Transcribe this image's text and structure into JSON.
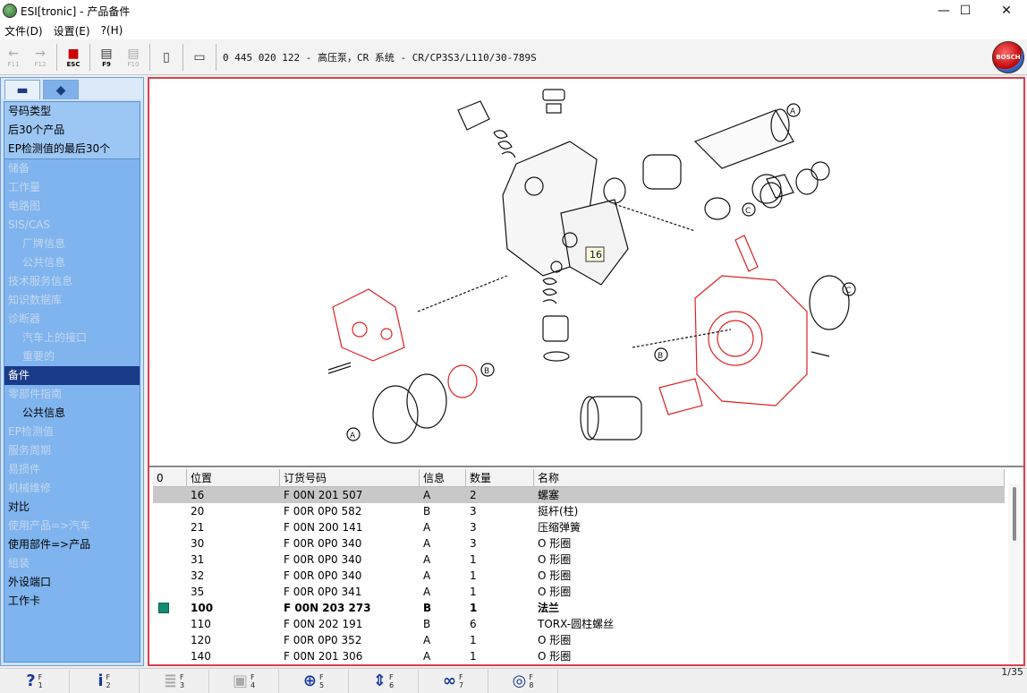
{
  "window": {
    "title": "ESI[tronic] - 产品备件",
    "minimize": "—",
    "maximize": "☐",
    "close": "✕"
  },
  "menu": [
    "文件(D)",
    "设置(E)",
    "?(H)"
  ],
  "toolbar": {
    "buttons": [
      {
        "icon": "arrow-left-icon",
        "glyph": "←",
        "key": "F11"
      },
      {
        "icon": "arrow-right-icon",
        "glyph": "→",
        "key": "F12"
      },
      {
        "icon": "esc-icon",
        "glyph": "■",
        "key": "ESC"
      },
      {
        "icon": "catalog-icon",
        "glyph": "▤",
        "key": "F9"
      },
      {
        "icon": "catalog-forward-icon",
        "glyph": "▤",
        "key": "F10"
      },
      {
        "icon": "document-icon",
        "glyph": "▯",
        "key": ""
      },
      {
        "icon": "print-icon",
        "glyph": "▭",
        "key": ""
      }
    ],
    "path": "0 445 020 122 - 高压泵，CR 系统 - CR/CP3S3/L110/30-789S",
    "logo_text": "BOSCH"
  },
  "sidebar": {
    "tabs": [
      {
        "icon": "car-icon",
        "glyph": "▬"
      },
      {
        "icon": "engine-icon",
        "glyph": "◆"
      }
    ],
    "top_items": [
      "号码类型",
      "后30个产品",
      "EP检测值的最后30个"
    ],
    "items": [
      {
        "label": "储备",
        "state": "grey",
        "indent": false
      },
      {
        "label": "工作量",
        "state": "grey",
        "indent": false
      },
      {
        "label": "电路图",
        "state": "grey",
        "indent": false
      },
      {
        "label": "SIS/CAS",
        "state": "grey",
        "indent": false
      },
      {
        "label": "厂牌信息",
        "state": "grey",
        "indent": true
      },
      {
        "label": "公共信息",
        "state": "grey",
        "indent": true
      },
      {
        "label": "技术服务信息",
        "state": "grey",
        "indent": false
      },
      {
        "label": "知识数据库",
        "state": "grey",
        "indent": false
      },
      {
        "label": "诊断器",
        "state": "grey",
        "indent": false
      },
      {
        "label": "汽车上的接口",
        "state": "grey",
        "indent": true
      },
      {
        "label": "重要的",
        "state": "grey",
        "indent": true
      },
      {
        "label": "备件",
        "state": "selected",
        "indent": false
      },
      {
        "label": "零部件指南",
        "state": "grey",
        "indent": false
      },
      {
        "label": "公共信息",
        "state": "normal",
        "indent": true
      },
      {
        "label": "EP检测值",
        "state": "grey",
        "indent": false
      },
      {
        "label": "服务周期",
        "state": "grey",
        "indent": false
      },
      {
        "label": "易损件",
        "state": "grey",
        "indent": false
      },
      {
        "label": "机械维修",
        "state": "grey",
        "indent": false
      },
      {
        "label": "对比",
        "state": "normal",
        "indent": false
      },
      {
        "label": "使用产品=>汽车",
        "state": "grey",
        "indent": false
      },
      {
        "label": "使用部件=>产品",
        "state": "normal",
        "indent": false
      },
      {
        "label": "组装",
        "state": "grey",
        "indent": false
      },
      {
        "label": "外设端口",
        "state": "normal",
        "indent": false
      },
      {
        "label": "工作卡",
        "state": "normal",
        "indent": false
      }
    ]
  },
  "diagram": {
    "callout": "16",
    "markers": [
      "A",
      "B",
      "C"
    ]
  },
  "table": {
    "columns": [
      "0",
      "位置",
      "订货号码",
      "信息",
      "数量",
      "名称"
    ],
    "rows": [
      {
        "pos": "16",
        "order": "F 00N 201 507",
        "info": "A",
        "qty": "2",
        "name": "螺塞",
        "state": "selected",
        "mark": false
      },
      {
        "pos": "20",
        "order": "F 00R 0P0 582",
        "info": "B",
        "qty": "3",
        "name": "挺杆(柱)",
        "state": "normal",
        "mark": false
      },
      {
        "pos": "21",
        "order": "F 00N 200 141",
        "info": "A",
        "qty": "3",
        "name": "压缩弹簧",
        "state": "normal",
        "mark": false
      },
      {
        "pos": "30",
        "order": "F 00R 0P0 340",
        "info": "A",
        "qty": "3",
        "name": "O 形圈",
        "state": "normal",
        "mark": false
      },
      {
        "pos": "31",
        "order": "F 00R 0P0 340",
        "info": "A",
        "qty": "1",
        "name": "O 形圈",
        "state": "normal",
        "mark": false
      },
      {
        "pos": "32",
        "order": "F 00R 0P0 340",
        "info": "A",
        "qty": "1",
        "name": "O 形圈",
        "state": "normal",
        "mark": false
      },
      {
        "pos": "35",
        "order": "F 00R 0P0 341",
        "info": "A",
        "qty": "1",
        "name": "O 形圈",
        "state": "normal",
        "mark": false
      },
      {
        "pos": "100",
        "order": "F 00N 203 273",
        "info": "B",
        "qty": "1",
        "name": "法兰",
        "state": "bold",
        "mark": true
      },
      {
        "pos": "110",
        "order": "F 00N 202 191",
        "info": "B",
        "qty": "6",
        "name": "TORX-圆柱螺丝",
        "state": "normal",
        "mark": false
      },
      {
        "pos": "120",
        "order": "F 00R 0P0 352",
        "info": "A",
        "qty": "1",
        "name": "O 形圈",
        "state": "normal",
        "mark": false
      },
      {
        "pos": "140",
        "order": "F 00N 201 306",
        "info": "A",
        "qty": "1",
        "name": "O 形圈",
        "state": "normal",
        "mark": false
      }
    ]
  },
  "bottombar": [
    {
      "icon": "help-icon",
      "glyph": "?",
      "key1": "F",
      "key2": "1",
      "disabled": false
    },
    {
      "icon": "info-icon",
      "glyph": "i",
      "key1": "F",
      "key2": "2",
      "disabled": false
    },
    {
      "icon": "list-icon",
      "glyph": "≣",
      "key1": "F",
      "key2": "3",
      "disabled": true
    },
    {
      "icon": "component-icon",
      "glyph": "▣",
      "key1": "F",
      "key2": "4",
      "disabled": true
    },
    {
      "icon": "zoom-icon",
      "glyph": "⊕",
      "key1": "F",
      "key2": "5",
      "disabled": false
    },
    {
      "icon": "split-icon",
      "glyph": "⇕",
      "key1": "F",
      "key2": "6",
      "disabled": false
    },
    {
      "icon": "binoculars-icon",
      "glyph": "∞",
      "key1": "F",
      "key2": "7",
      "disabled": false
    },
    {
      "icon": "target-icon",
      "glyph": "◎",
      "key1": "F",
      "key2": "8",
      "disabled": false
    }
  ],
  "page_indicator": "1/35"
}
